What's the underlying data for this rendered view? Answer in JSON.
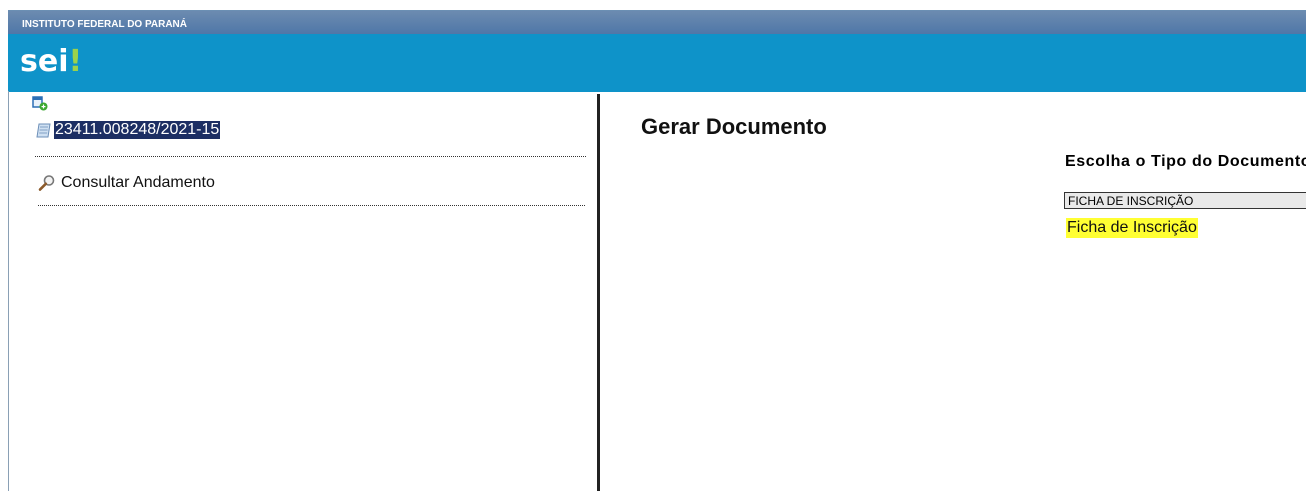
{
  "header": {
    "org_name": "INSTITUTO FEDERAL DO PARANÁ",
    "logo_text": "sei",
    "logo_mark": "!"
  },
  "tree": {
    "toggle_icon": "tree-expand-icon",
    "process_icon": "process-document-icon",
    "process_number": "23411.008248/2021-15",
    "consult_icon": "magnifier-icon",
    "consult_label": "Consultar Andamento"
  },
  "main": {
    "title": "Gerar Documento",
    "choose_label": "Escolha o Tipo do Documento:",
    "type_filter_value": "FICHA DE INSCRIÇÃO",
    "results": [
      "Ficha de Inscrição"
    ]
  },
  "colors": {
    "header_bg": "#0e93c9",
    "org_bar": "#5a80ad",
    "selection_bg": "#1c2e63",
    "highlight": "#ffff33"
  }
}
